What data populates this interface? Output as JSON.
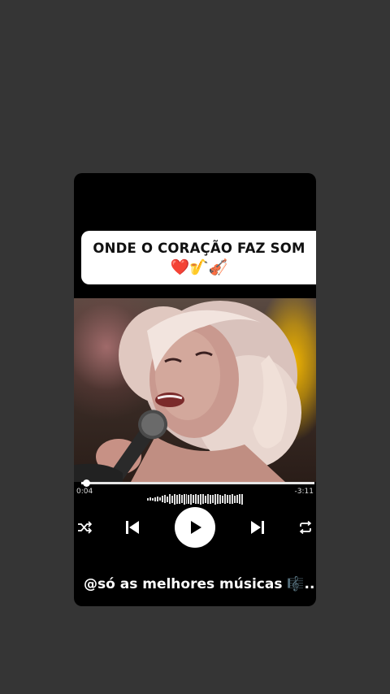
{
  "banner": {
    "title": "ONDE O CORAÇÃO FAZ SOM",
    "emojis": "❤️🎷🎻"
  },
  "player": {
    "elapsed": "0:04",
    "remaining": "-3:11",
    "progress_fraction": 0.02,
    "controls": {
      "shuffle_icon": "shuffle-icon",
      "previous_icon": "skip-previous-icon",
      "play_icon": "play-icon",
      "next_icon": "skip-next-icon",
      "repeat_icon": "repeat-icon"
    }
  },
  "caption": "@só as melhores músicas 🎼...",
  "colors": {
    "background": "#353535",
    "card": "#000000",
    "accent": "#ffffff"
  }
}
